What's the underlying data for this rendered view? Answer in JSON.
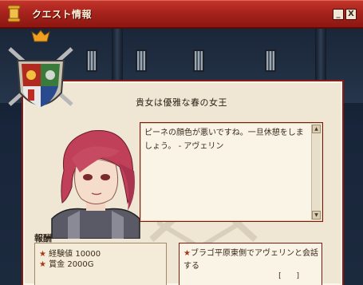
{
  "window": {
    "title": "クエスト情報",
    "minimize_label": "_",
    "close_label": "X"
  },
  "quest": {
    "title": "貴女は優雅な春の女王"
  },
  "dialogue": {
    "text": "ピーネの顔色が悪いですね。一旦休憩をしましょう。 - アヴェリン"
  },
  "reward": {
    "label": "報酬",
    "items": [
      {
        "bullet": "★",
        "text": "経験値 10000"
      },
      {
        "bullet": "★",
        "text": "賞金 2000G"
      }
    ]
  },
  "objective": {
    "bullet": "★",
    "text": "ブラゴ平原東側でアヴェリンと会話する",
    "progress": "[ ]"
  },
  "colors": {
    "titlebar": "#a8231d",
    "panel_border": "#8c1a14",
    "parchment": "#efe7d4",
    "text": "#3b2a1a"
  }
}
